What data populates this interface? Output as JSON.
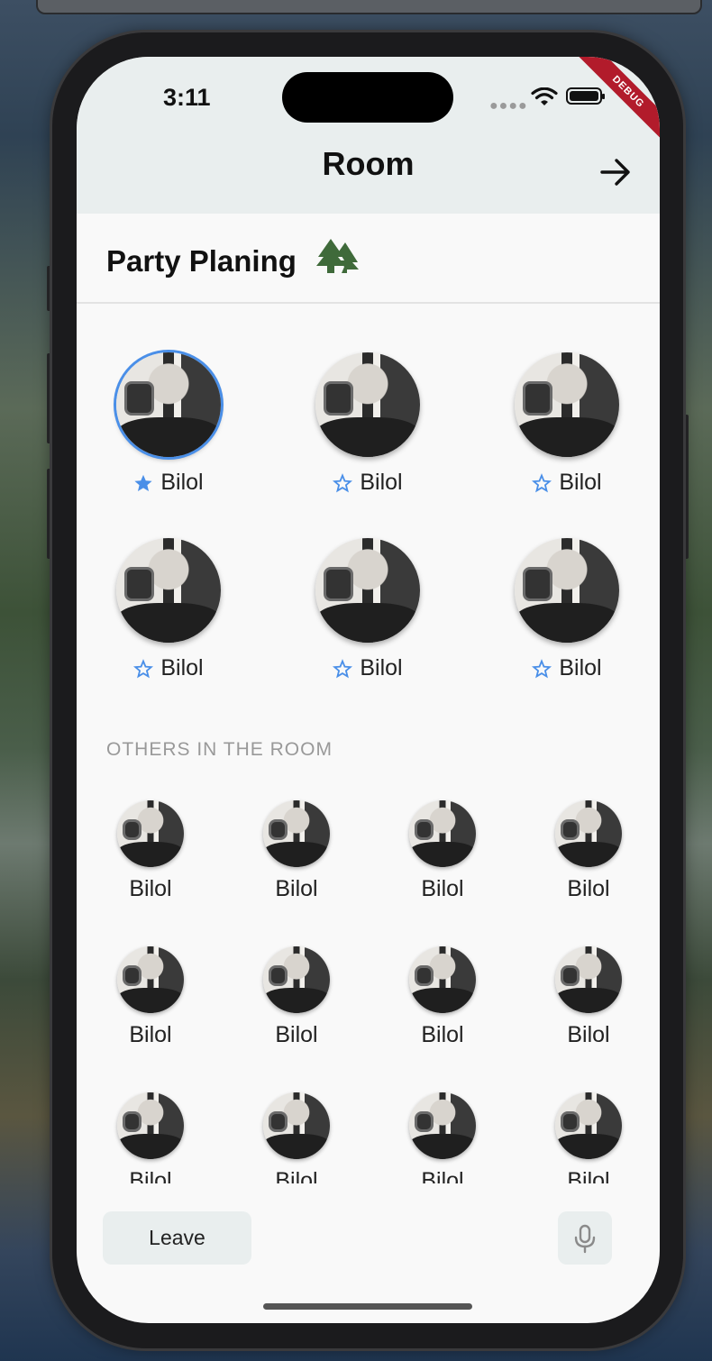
{
  "status_bar": {
    "time": "3:11",
    "debug_banner": "DEBUG"
  },
  "appbar": {
    "title": "Room",
    "forward_icon": "arrow-right-icon"
  },
  "room": {
    "name": "Party Planing",
    "icon": "tree-icon"
  },
  "speakers": [
    {
      "name": "Bilol",
      "starred": true
    },
    {
      "name": "Bilol",
      "starred": false
    },
    {
      "name": "Bilol",
      "starred": false
    },
    {
      "name": "Bilol",
      "starred": false
    },
    {
      "name": "Bilol",
      "starred": false
    },
    {
      "name": "Bilol",
      "starred": false
    }
  ],
  "others": {
    "label": "OTHERS IN THE ROOM",
    "listeners": [
      "Bilol",
      "Bilol",
      "Bilol",
      "Bilol",
      "Bilol",
      "Bilol",
      "Bilol",
      "Bilol",
      "Bilol",
      "Bilol",
      "Bilol",
      "Bilol"
    ]
  },
  "bottom": {
    "leave_label": "Leave",
    "mic_icon": "microphone-icon"
  },
  "colors": {
    "accent": "#4a8fe8",
    "appbar_bg": "#e9eeee",
    "debug_banner": "#b21b2b",
    "tree": "#3f6a3a"
  }
}
